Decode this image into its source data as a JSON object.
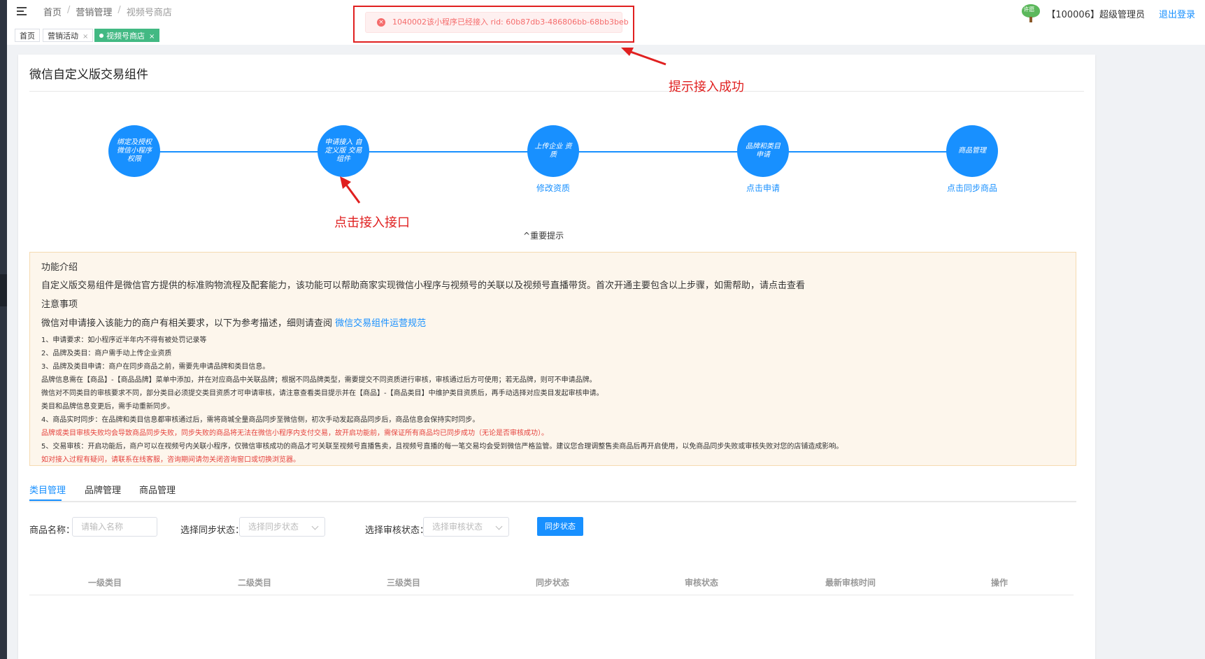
{
  "breadcrumb": {
    "home": "首页",
    "marketing": "营销管理",
    "current": "视频号商店"
  },
  "user": {
    "avatar_text": "许愿",
    "name": "【100006】超级管理员",
    "logout": "退出登录"
  },
  "page_tabs": [
    {
      "label": "首页"
    },
    {
      "label": "营销活动"
    },
    {
      "label": "视频号商店"
    }
  ],
  "toast": {
    "message": "1040002该小程序已经接入 rid: 60b87db3-486806bb-68bb3beb"
  },
  "annotations": {
    "toast_note": "提示接入成功",
    "step_note": "点击接入接口"
  },
  "page_title": "微信自定义版交易组件",
  "steps": [
    {
      "label": "绑定及授权微信小程序权限",
      "link": ""
    },
    {
      "label": "申请接入 自定义版 交易组件",
      "link": ""
    },
    {
      "label": "上传企业 资质",
      "link": "修改资质"
    },
    {
      "label": "品牌和类目 申请",
      "link": "点击申请"
    },
    {
      "label": "商品管理",
      "link": "点击同步商品"
    }
  ],
  "tips_toggle": "重要提示",
  "notice": {
    "h1": "功能介绍",
    "p1": "自定义版交易组件是微信官方提供的标准购物流程及配套能力，该功能可以帮助商家实现微信小程序与视频号的关联以及视频号直播带货。首次开通主要包含以上步骤，如需帮助，请点击查看",
    "h2": "注意事项",
    "p2": "微信对申请接入该能力的商户有相关要求，以下为参考描述，细则请查阅",
    "p2_link": "微信交易组件运营规范",
    "l1": "1、申请要求：如小程序近半年内不得有被处罚记录等",
    "l2": "2、品牌及类目：商户需手动上传企业资质",
    "l3": "3、品牌及类目申请：商户在同步商品之前，需要先申请品牌和类目信息。",
    "l4": "品牌信息需在【商品】-【商品品牌】菜单中添加，并在对应商品中关联品牌；根据不同品牌类型，需要提交不同资质进行审核，审核通过后方可使用；若无品牌，则可不申请品牌。",
    "l5": "微信对不同类目的审核要求不同，部分类目必须提交类目资质才可申请审核，请注意查看类目提示并在【商品】-【商品类目】中维护类目资质后，再手动选择对应类目发起审核申请。",
    "l6": "类目和品牌信息变更后，需手动重新同步。",
    "l7": "4、商品实时同步：在品牌和类目信息都审核通过后，需将商城全量商品同步至微信侧，初次手动发起商品同步后，商品信息会保持实时同步。",
    "l8": "品牌或类目审核失败均会导致商品同步失败，同步失败的商品将无法在微信小程序内支付交易，故开启功能前，需保证所有商品均已同步成功（无论是否审核成功）。",
    "l9": "5、交易审核：开启功能后，商户可以在视频号内关联小程序，仅微信审核成功的商品才可关联至视频号直播售卖，且视频号直播的每一笔交易均会受到微信严格监管。建议您合理调整售卖商品后再开启使用，以免商品同步失败或审核失败对您的店铺造成影响。",
    "l10": "如对接入过程有疑问，请联系在线客服，咨询期间请勿关闭咨询窗口或切换浏览器。"
  },
  "content_tabs": [
    "类目管理",
    "品牌管理",
    "商品管理"
  ],
  "filters": {
    "name_label": "商品名称：",
    "name_placeholder": "请输入名称",
    "sync_label": "选择同步状态：",
    "sync_placeholder": "选择同步状态",
    "audit_label": "选择审核状态：",
    "audit_placeholder": "选择审核状态",
    "sync_button": "同步状态"
  },
  "table_headers": [
    "一级类目",
    "二级类目",
    "三级类目",
    "同步状态",
    "审核状态",
    "最新审核时间",
    "操作"
  ],
  "colors": {
    "primary": "#1890ff",
    "active_tab": "#42b983",
    "annotation": "#e02020",
    "notice_bg": "#fdf6ec"
  }
}
